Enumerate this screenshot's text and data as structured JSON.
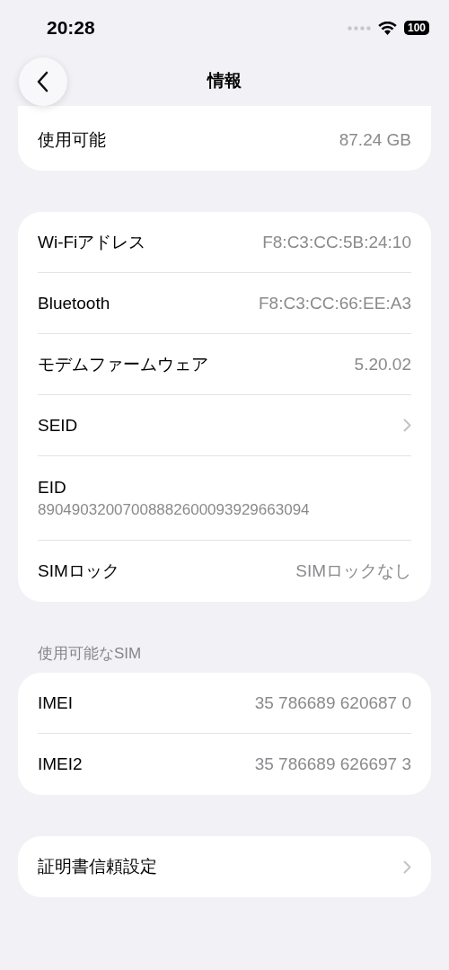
{
  "status_bar": {
    "time": "20:28",
    "battery": "100"
  },
  "nav": {
    "title": "情報"
  },
  "groups": [
    {
      "rows": [
        {
          "kind": "value",
          "label": "使用可能",
          "value": "87.24 GB"
        }
      ]
    },
    {
      "rows": [
        {
          "kind": "value",
          "label": "Wi-Fiアドレス",
          "value": "F8:C3:CC:5B:24:10"
        },
        {
          "kind": "value",
          "label": "Bluetooth",
          "value": "F8:C3:CC:66:EE:A3"
        },
        {
          "kind": "value",
          "label": "モデムファームウェア",
          "value": "5.20.02"
        },
        {
          "kind": "chevron",
          "label": "SEID"
        },
        {
          "kind": "stacked",
          "label": "EID",
          "value": "89049032007008882600093929663094"
        },
        {
          "kind": "value",
          "label": "SIMロック",
          "value": "SIMロックなし"
        }
      ]
    },
    {
      "header": "使用可能なSIM",
      "rows": [
        {
          "kind": "value",
          "label": "IMEI",
          "value": "35 786689 620687 0"
        },
        {
          "kind": "value",
          "label": "IMEI2",
          "value": "35 786689 626697 3"
        }
      ]
    },
    {
      "rows": [
        {
          "kind": "chevron",
          "label": "証明書信頼設定"
        }
      ]
    }
  ]
}
